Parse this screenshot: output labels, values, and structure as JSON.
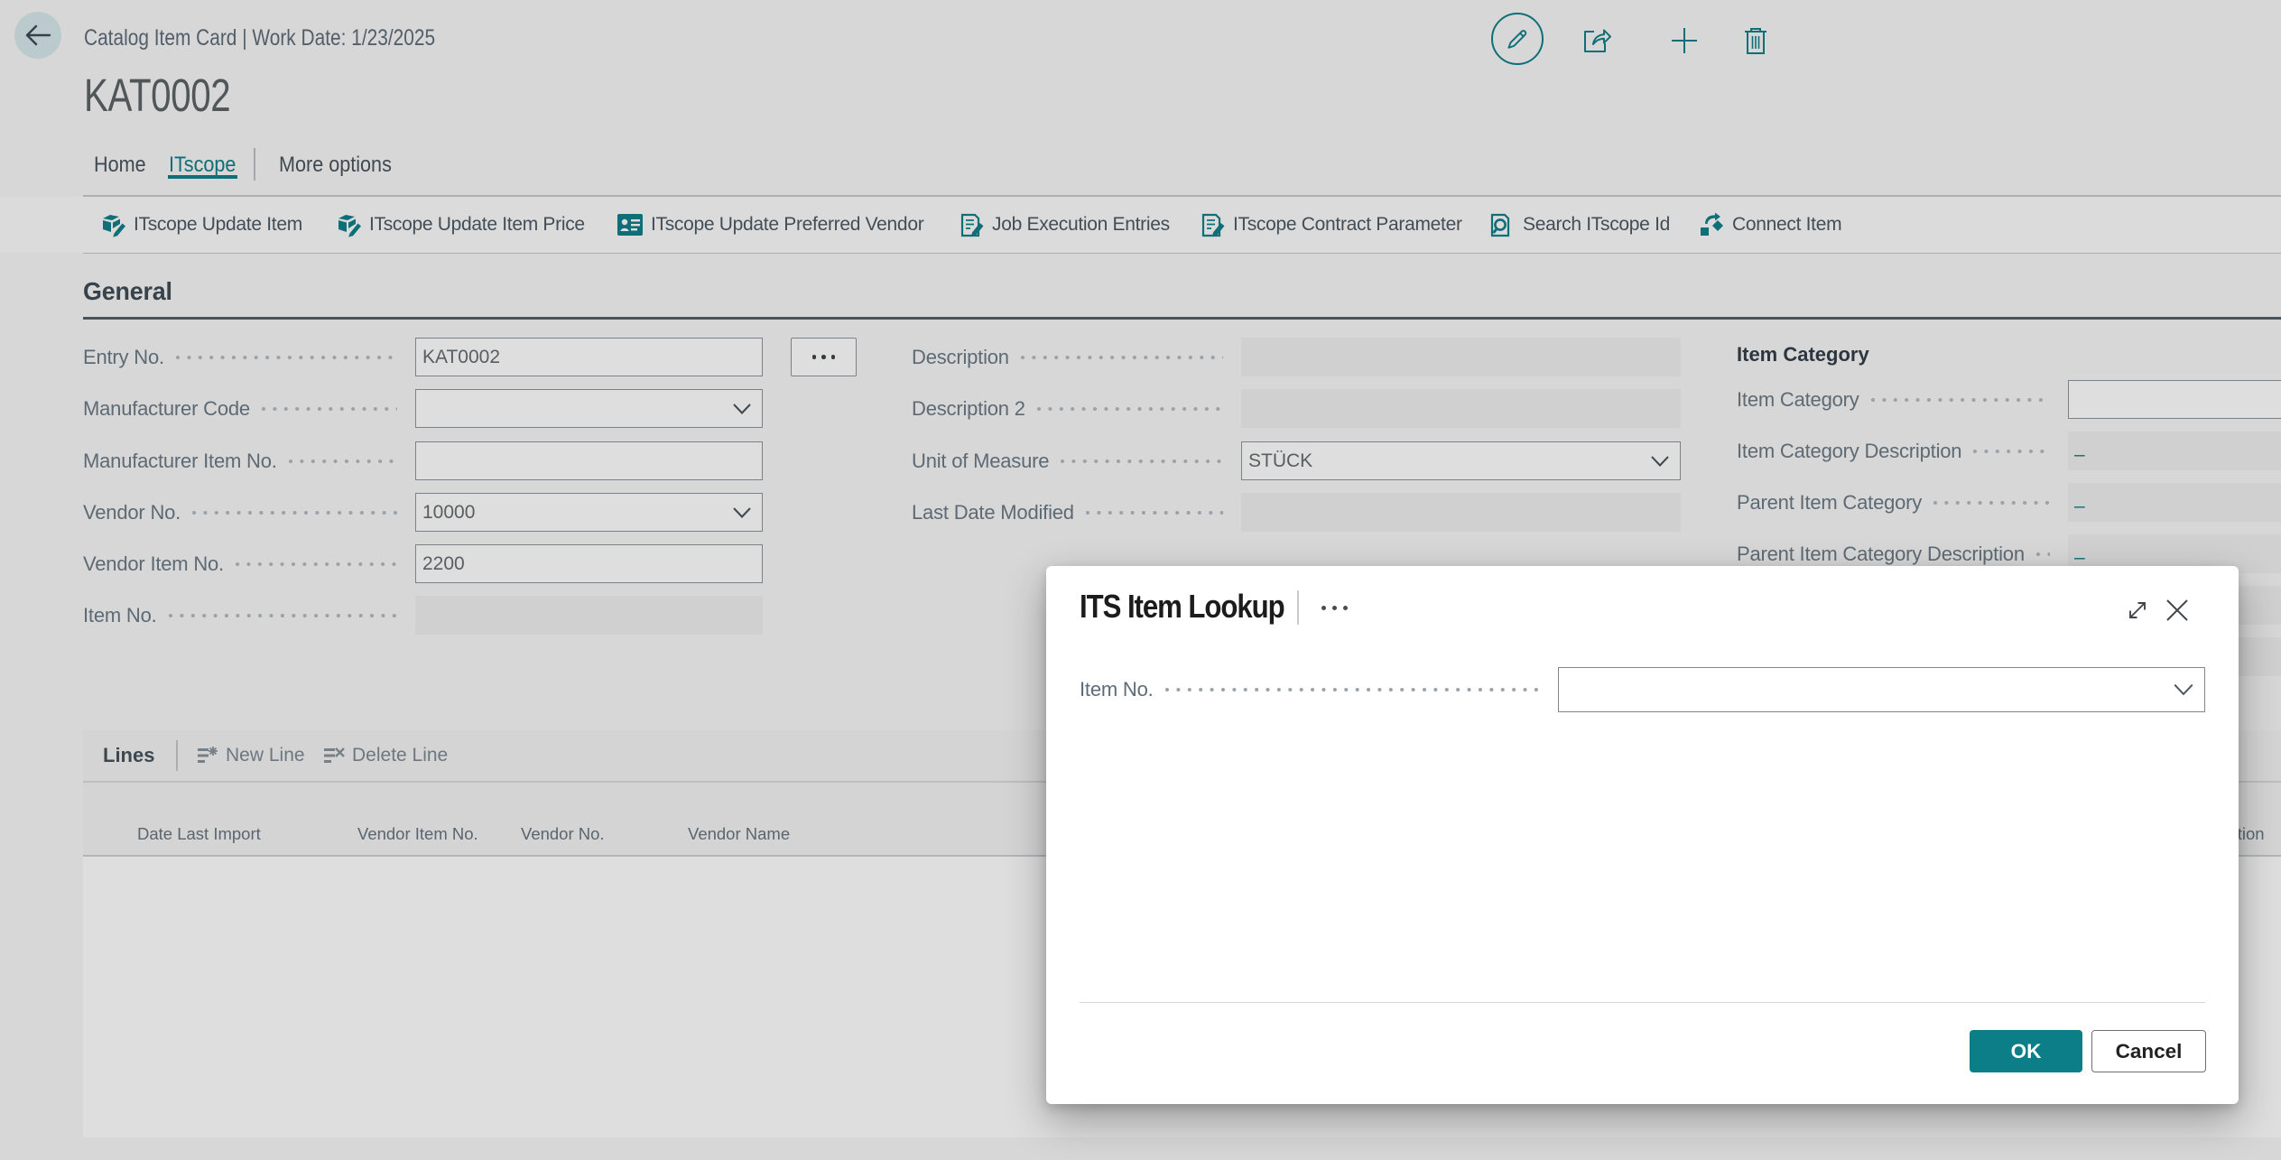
{
  "colors": {
    "accent": "#12808a",
    "ok_button": "#0b7e88"
  },
  "header": {
    "caption": "Catalog Item Card | Work Date: 1/23/2025",
    "title": "KAT0002"
  },
  "tabs": {
    "home": "Home",
    "itscope": "ITscope",
    "more": "More options"
  },
  "actions": [
    {
      "label": "ITscope Update Item",
      "icon": "box-pencil-icon"
    },
    {
      "label": "ITscope Update Item Price",
      "icon": "box-pencil-icon"
    },
    {
      "label": "ITscope Update Preferred Vendor",
      "icon": "vendor-badge-icon"
    },
    {
      "label": "Job Execution Entries",
      "icon": "doc-pencil-icon"
    },
    {
      "label": "ITscope Contract Parameter",
      "icon": "doc-pencil-icon"
    },
    {
      "label": "Search ITscope Id",
      "icon": "doc-search-icon"
    },
    {
      "label": "Connect Item",
      "icon": "connect-icon"
    }
  ],
  "general": {
    "heading": "General",
    "left": [
      {
        "label": "Entry No.",
        "value": "KAT0002"
      },
      {
        "label": "Manufacturer Code",
        "value": ""
      },
      {
        "label": "Manufacturer Item No.",
        "value": ""
      },
      {
        "label": "Vendor No.",
        "value": "10000"
      },
      {
        "label": "Vendor Item No.",
        "value": "2200"
      },
      {
        "label": "Item No.",
        "value": ""
      }
    ],
    "middle": [
      {
        "label": "Description",
        "value": ""
      },
      {
        "label": "Description 2",
        "value": ""
      },
      {
        "label": "Unit of Measure",
        "value": "STÜCK"
      },
      {
        "label": "Last Date Modified",
        "value": ""
      }
    ],
    "right_group": {
      "heading": "Item Category",
      "rows": [
        {
          "label": "Item Category",
          "value": ""
        },
        {
          "label": "Item Category Description",
          "value": "–"
        },
        {
          "label": "Parent Item Category",
          "value": "–"
        },
        {
          "label": "Parent Item Category Description",
          "value": "–"
        },
        {
          "label": "",
          "value": "–"
        },
        {
          "label": "",
          "value": "–"
        }
      ]
    }
  },
  "lines": {
    "title": "Lines",
    "new_line": "New Line",
    "delete_line": "Delete Line",
    "columns": [
      "Date Last Import",
      "Vendor Item No.",
      "Vendor No.",
      "Vendor Name",
      "Description"
    ]
  },
  "dialog": {
    "title": "ITS Item Lookup",
    "field_label": "Item No.",
    "field_value": "",
    "ok": "OK",
    "cancel": "Cancel"
  }
}
